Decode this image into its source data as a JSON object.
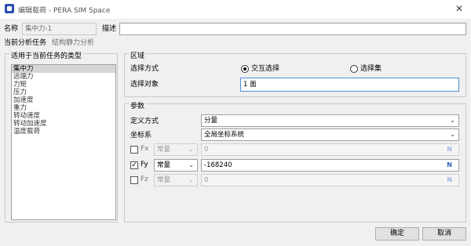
{
  "window": {
    "title": "编辑载荷 - PERA SIM Space",
    "close_glyph": "✕"
  },
  "name_row": {
    "label": "名称",
    "value": "集中力-1",
    "desc_label": "描述",
    "desc_value": ""
  },
  "task_row": {
    "label": "当前分析任务",
    "value": "结构静力分析"
  },
  "types_group": {
    "title": "适用于当前任务的类型",
    "items": [
      "集中力",
      "远端力",
      "力矩",
      "压力",
      "加速度",
      "重力",
      "转动速度",
      "转动加速度",
      "温度载荷"
    ],
    "selected_index": 0
  },
  "region_group": {
    "title": "区域",
    "select_mode_label": "选择方式",
    "options": [
      "交互选择",
      "选择集"
    ],
    "selected_option": "交互选择",
    "target_label": "选择对象",
    "target_value": "1 面"
  },
  "params_group": {
    "title": "参数",
    "define_label": "定义方式",
    "define_value": "分量",
    "coord_label": "坐标系",
    "coord_value": "全局坐标系统",
    "components": [
      {
        "name": "Fx",
        "checked": false,
        "mode": "常量",
        "value": "0",
        "unit": "N"
      },
      {
        "name": "Fy",
        "checked": true,
        "mode": "常量",
        "value": "-168240",
        "unit": "N"
      },
      {
        "name": "Fz",
        "checked": false,
        "mode": "常量",
        "value": "0",
        "unit": "N"
      }
    ]
  },
  "footer": {
    "ok_label": "确定",
    "cancel_label": "取消"
  },
  "icons": {
    "check": "✓",
    "chevron": "⌄"
  }
}
